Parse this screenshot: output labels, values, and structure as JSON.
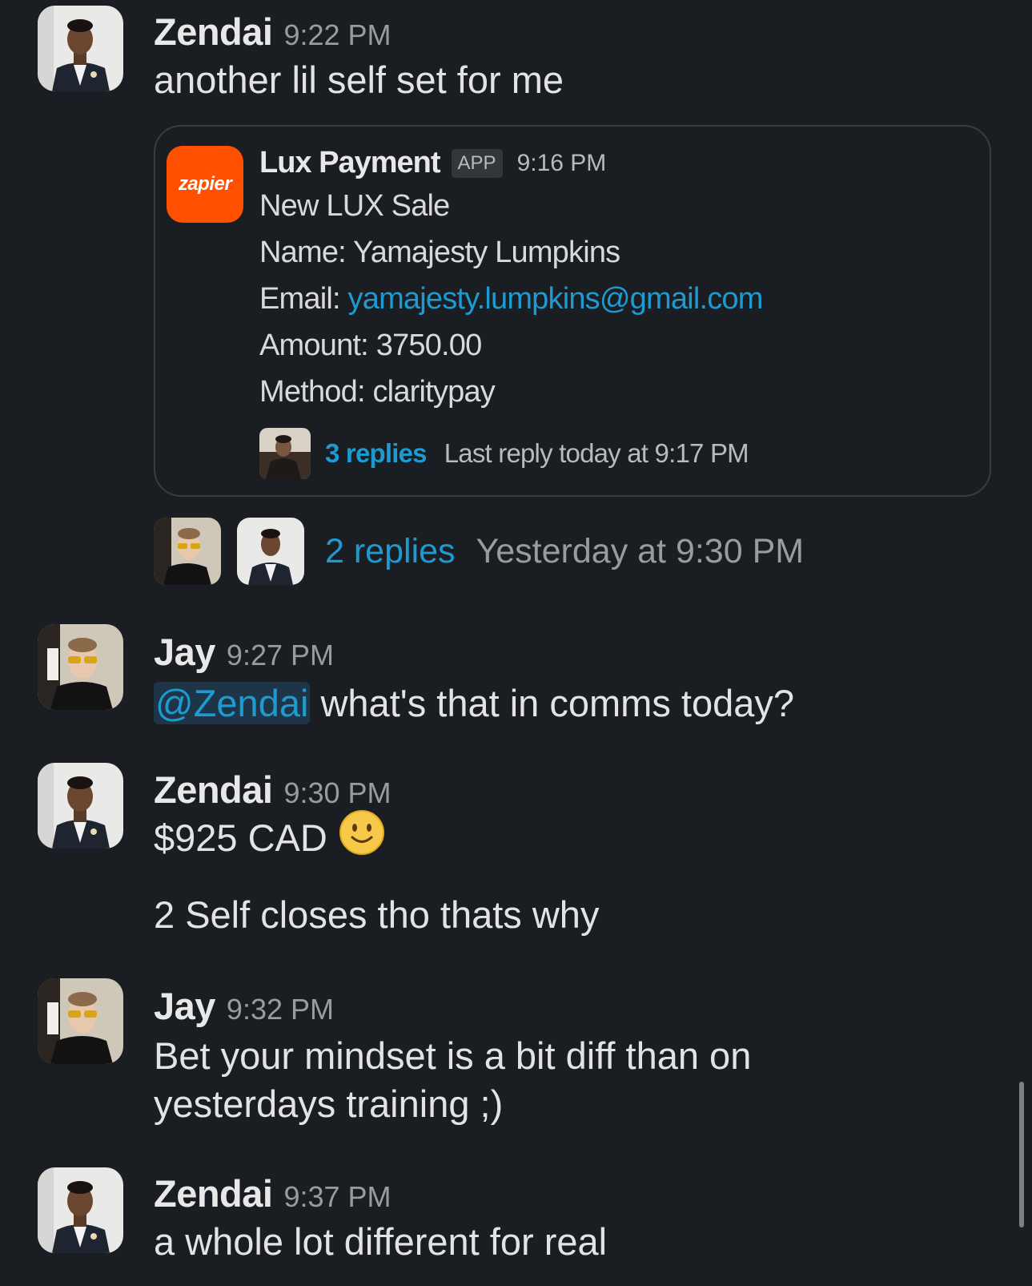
{
  "colors": {
    "background": "#1a1d21",
    "link": "#1d9bd1",
    "zapier_orange": "#ff4f00",
    "mention_bg": "#1d3547"
  },
  "messages": [
    {
      "sender": "Zendai",
      "time": "9:22 PM",
      "avatar_icon": "zendai-avatar-icon",
      "text": "another lil self set for me"
    },
    {
      "sender": "Jay",
      "time": "9:27 PM",
      "avatar_icon": "jay-avatar-icon",
      "mention": "@Zendai",
      "text": " what's that in comms today?"
    },
    {
      "sender": "Zendai",
      "time": "9:30 PM",
      "avatar_icon": "zendai-avatar-icon",
      "text": "$925 CAD",
      "emoji": "slightly-smiling-face-icon",
      "text2": "2 Self closes tho thats why"
    },
    {
      "sender": "Jay",
      "time": "9:32 PM",
      "avatar_icon": "jay-avatar-icon",
      "text": "Bet your mindset is a bit diff than on",
      "text2": "yesterdays training ;)"
    },
    {
      "sender": "Zendai",
      "time": "9:37 PM",
      "avatar_icon": "zendai-avatar-icon",
      "text": "a whole lot different for real"
    }
  ],
  "attachment": {
    "logo_text": "zapier",
    "title": "Lux Payment",
    "badge": "APP",
    "time": "9:16 PM",
    "line1": "New LUX Sale",
    "name_label": "Name:",
    "name_value": "Yamajesty Lumpkins",
    "email_label": "Email:",
    "email_value": "yamajesty.lumpkins@gmail.com",
    "amount_label": "Amount:",
    "amount_value": "3750.00",
    "method_label": "Method:",
    "method_value": "claritypay",
    "thread": {
      "replies": "3 replies",
      "last_reply": "Last reply today at 9:17 PM"
    }
  },
  "thread": {
    "replies": "2 replies",
    "last_reply": "Yesterday at 9:30 PM"
  }
}
